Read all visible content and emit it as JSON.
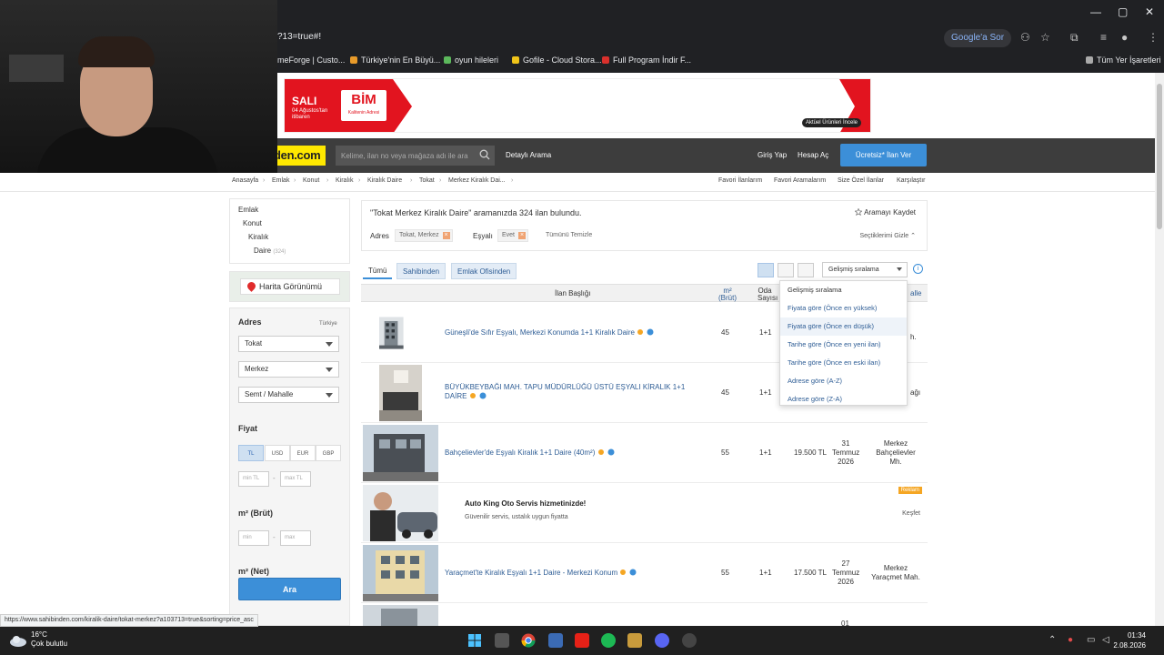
{
  "browser": {
    "url_fragment": "?13=true#!",
    "google_button": "Google'a Sor",
    "bookmarks": [
      "meForge | Custo...",
      "Türkiye'nin En Büyü...",
      "oyun hileleri",
      "Gofile - Cloud Stora...",
      "Full Program İndir F...",
      "Tüm Yer İşaretleri"
    ],
    "status_url": "https://www.sahibinden.com/kiralik-daire/tokat-merkez?a103713=true&sorting=price_asc"
  },
  "ad": {
    "day": "SALI",
    "date_line": "04 Ağustos'tan itibaren",
    "brand": "BİM",
    "brand_sub": "Kalitenin Adresi",
    "button": "Aktüel Ürünleri İncele"
  },
  "header": {
    "logo": "sahibinden.com",
    "search_placeholder": "Kelime, ilan no veya mağaza adı ile ara",
    "detailed_search": "Detaylı Arama",
    "login": "Giriş Yap",
    "register": "Hesap Aç",
    "post_ad": "Ücretsiz* İlan Ver"
  },
  "breadcrumb": {
    "items": [
      "Anasayfa",
      "Emlak",
      "Konut",
      "Kiralık",
      "Kiralık Daire",
      "Tokat",
      "Merkez Kiralık Dai..."
    ],
    "right": [
      "Favori İlanlarım",
      "Favori Aramalarım",
      "Size Özel İlanlar",
      "Karşılaştır"
    ]
  },
  "categories": {
    "emlak": "Emlak",
    "konut": "Konut",
    "kiralik": "Kiralık",
    "daire": "Daire",
    "daire_count": "(324)"
  },
  "map_button": "Harita Görünümü",
  "filters": {
    "address_title": "Adres",
    "country": "Türkiye",
    "city": "Tokat",
    "district": "Merkez",
    "neighborhood": "Semt / Mahalle",
    "price_title": "Fiyat",
    "currencies": [
      "TL",
      "USD",
      "EUR",
      "GBP"
    ],
    "price_min": "min TL",
    "price_max": "max TL",
    "gross_title": "m² (Brüt)",
    "gross_min": "min",
    "gross_max": "max",
    "net_title": "m² (Net)",
    "search_btn": "Ara"
  },
  "result": {
    "text": "\"Tokat Merkez Kiralık Daire\" aramanızda 324 ilan bulundu.",
    "save": "Aramayı Kaydet",
    "address_label": "Adres",
    "address_tag": "Tokat, Merkez",
    "furnished_label": "Eşyalı",
    "furnished_tag": "Evet",
    "clear": "Tümünü Temizle",
    "selected": "Seçtiklerimi Gizle"
  },
  "tabs": [
    "Tümü",
    "Sahibinden",
    "Emlak Ofisinden"
  ],
  "sort": {
    "current": "Gelişmiş sıralama",
    "options": [
      "Gelişmiş sıralama",
      "Fiyata göre (Önce en yüksek)",
      "Fiyata göre (Önce en düşük)",
      "Tarihe göre (Önce en yeni ilan)",
      "Tarihe göre (Önce en eski ilan)",
      "Adrese göre (A-Z)",
      "Adrese göre (Z-A)"
    ]
  },
  "table_headers": {
    "title": "İlan Başlığı",
    "m2": "m²",
    "m2_sub": "(Brüt)",
    "room": "Oda",
    "room_sub": "Sayısı",
    "mahalle": "alle"
  },
  "listings": [
    {
      "title": "Güneşli'de Sıfır Eşyalı, Merkezi Konumda 1+1 Kiralık Daire",
      "m2": "45",
      "room": "1+1",
      "extra": "h."
    },
    {
      "title": "BÜYÜKBEYBAĞI MAH. TAPU MÜDÜRLÜĞÜ ÜSTÜ EŞYALI KİRALIK 1+1 DAİRE",
      "m2": "45",
      "room": "1+1",
      "extra": "ağı"
    },
    {
      "title": "Bahçelievler'de Eşyalı Kiralık 1+1 Daire (40m²)",
      "m2": "55",
      "room": "1+1",
      "price": "19.500 TL",
      "date_1": "31",
      "date_2": "Temmuz",
      "date_3": "2026",
      "loc_1": "Merkez",
      "loc_2": "Bahçelievler",
      "loc_3": "Mh."
    },
    {
      "title": "Yaraçmet'te Kiralık Eşyalı 1+1 Daire - Merkezi Konum",
      "m2": "55",
      "room": "1+1",
      "price": "17.500 TL",
      "date_1": "27",
      "date_2": "Temmuz",
      "date_3": "2026",
      "loc_1": "Merkez",
      "loc_2": "Yaraçmet Mah."
    }
  ],
  "ad_row": {
    "title": "Auto King Oto Servis hizmetinizde!",
    "subtitle": "Güvenilir servis, ustalık uygun fiyatta",
    "badge": "Reklam",
    "cta": "Keşfet"
  },
  "partial_row_date": "01",
  "taskbar": {
    "temp": "16°C",
    "weather": "Çok bulutlu",
    "time": "01:34",
    "date": "2.08.2026"
  },
  "colors": {
    "brand_yellow": "#ffe800",
    "header_dark": "#3d3d3d",
    "link_blue": "#2e5d95",
    "button_blue": "#3c8fd8",
    "bim_red": "#e2141f"
  }
}
